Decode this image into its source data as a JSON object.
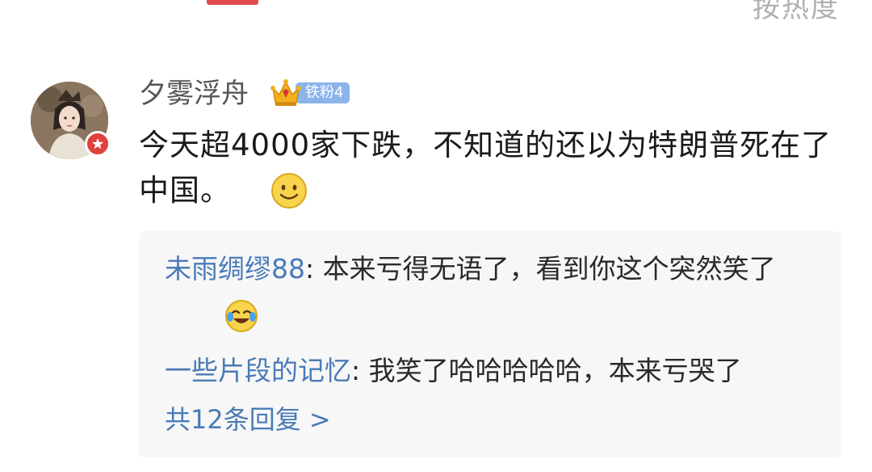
{
  "header": {
    "sort_label": "按热度"
  },
  "comment": {
    "username": "夕雾浮舟",
    "fan_badge": "铁粉4",
    "text": "今天超4000家下跌，不知道的还以为特朗普死在了中国。",
    "emoji": "smile-emoji"
  },
  "replies": {
    "items": [
      {
        "name": "未雨绸缪88",
        "text": ": 本来亏得无语了，看到你这个突然笑了",
        "emoji": "laugh-cry-emoji"
      },
      {
        "name": "一些片段的记忆",
        "text": ": 我笑了哈哈哈哈哈，本来亏哭了"
      }
    ],
    "more_label": "共12条回复 >"
  },
  "colors": {
    "link_blue": "#4a7bb7",
    "badge_red": "#e0413b",
    "fan_pill": "#8ab4ea",
    "reply_bg": "#f7f7f7"
  }
}
